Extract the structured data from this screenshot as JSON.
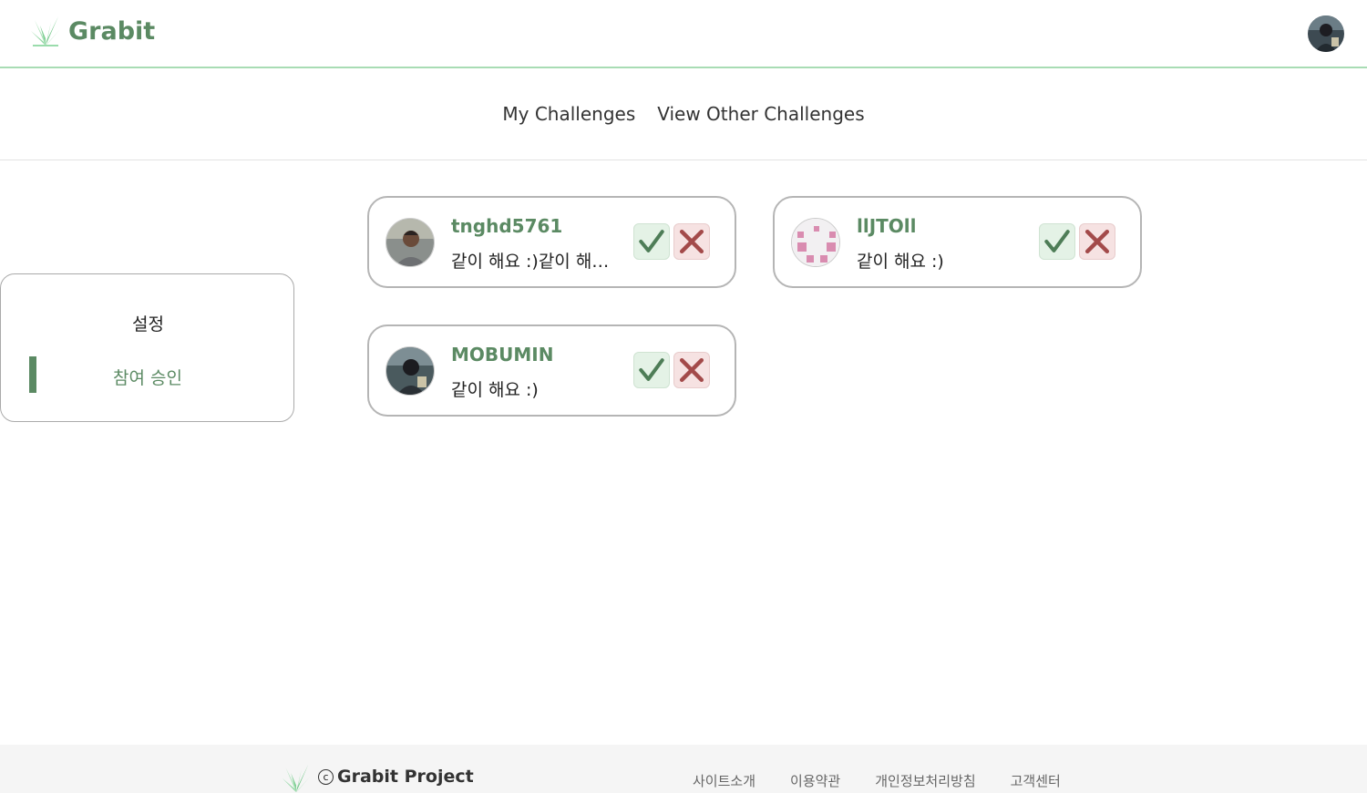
{
  "header": {
    "logo_text": "Grabit",
    "logo_icon": "grass-icon",
    "profile_avatar": "user-avatar"
  },
  "nav": {
    "items": [
      {
        "label": "My Challenges"
      },
      {
        "label": "View Other Challenges"
      }
    ]
  },
  "sidebar": {
    "title": "설정",
    "items": [
      {
        "label": "참여 승인",
        "active": true
      }
    ]
  },
  "requests": [
    {
      "username": "tnghd5761",
      "message": "같이 해요 :)같이 해요 :)",
      "avatar": "photo-avatar"
    },
    {
      "username": "llJTOll",
      "message": "같이 해요 :)",
      "avatar": "pixel-face-avatar"
    },
    {
      "username": "MOBUMIN",
      "message": "같이 해요 :)",
      "avatar": "photo-avatar"
    }
  ],
  "footer": {
    "brand": "Grabit Project",
    "copyright_symbol": "c",
    "links": [
      {
        "label": "사이트소개"
      },
      {
        "label": "이용약관"
      },
      {
        "label": "개인정보처리방침"
      },
      {
        "label": "고객센터"
      }
    ]
  },
  "colors": {
    "brand_green": "#5b8a63",
    "accent_green_line": "#a8dcb4",
    "accept_bg": "#e4f2e6",
    "reject_bg": "#f6e2e2",
    "reject_icon": "#a34a4a"
  }
}
